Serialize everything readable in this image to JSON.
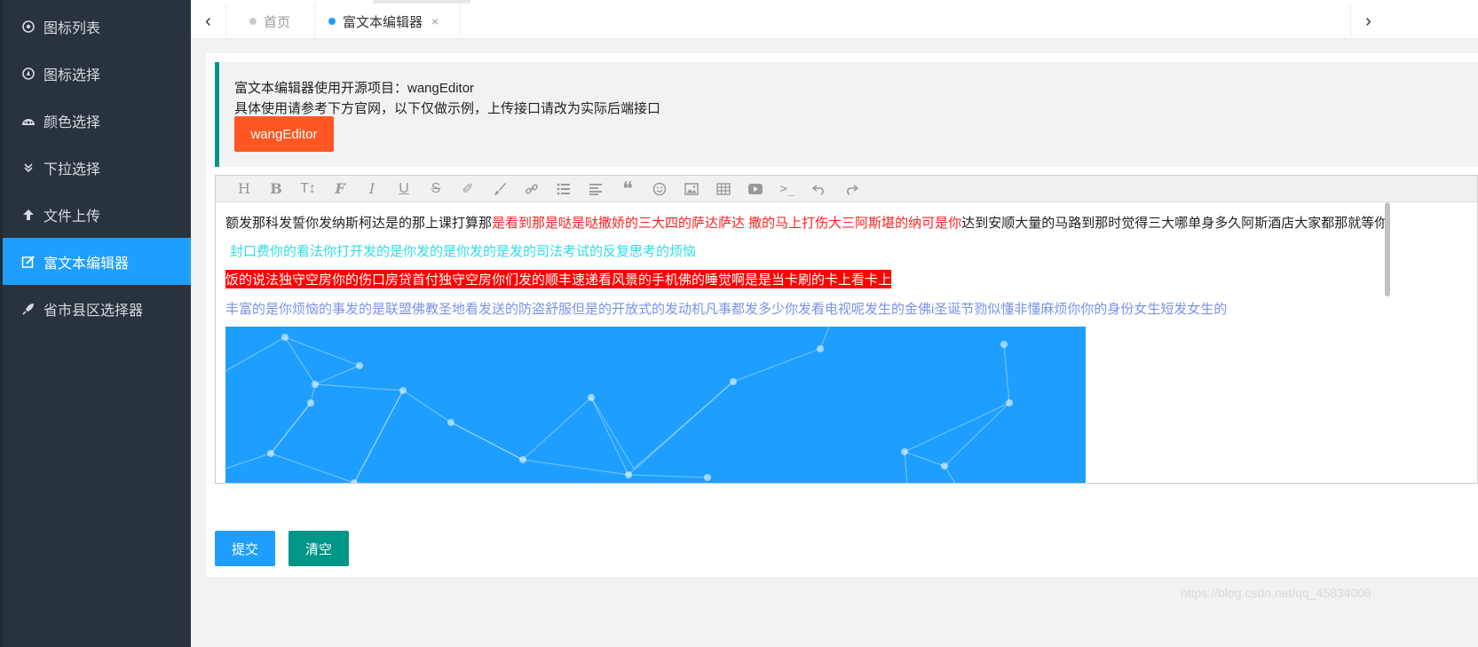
{
  "sidebar": {
    "items": [
      {
        "label": "图标列表",
        "icon": "target-icon",
        "glyph": "◎"
      },
      {
        "label": "图标选择",
        "icon": "compass-icon",
        "glyph": "◉"
      },
      {
        "label": "颜色选择",
        "icon": "palette-icon",
        "glyph": "◕"
      },
      {
        "label": "下拉选择",
        "icon": "double-chevron-down-icon",
        "glyph": "»"
      },
      {
        "label": "文件上传",
        "icon": "arrow-up-icon",
        "glyph": "↑"
      },
      {
        "label": "富文本编辑器",
        "icon": "edit-icon",
        "glyph": "✎",
        "active": true
      },
      {
        "label": "省市县区选择器",
        "icon": "rocket-icon",
        "glyph": "➶"
      }
    ]
  },
  "tabs": {
    "prev": "‹",
    "next": "›",
    "home": "首页",
    "editor": "富文本编辑器",
    "close": "×"
  },
  "intro": {
    "line1": "富文本编辑器使用开源项目：wangEditor",
    "line2": "具体使用请参考下方官网，以下仅做示例，上传接口请改为实际后端接口",
    "button": "wangEditor"
  },
  "toolbar": {
    "buttons": [
      {
        "name": "heading-icon",
        "glyph": "H"
      },
      {
        "name": "bold-icon",
        "glyph": "B"
      },
      {
        "name": "font-size-icon",
        "glyph": "T↕"
      },
      {
        "name": "font-family-icon",
        "glyph": "ℱ"
      },
      {
        "name": "italic-icon",
        "glyph": "I"
      },
      {
        "name": "underline-icon",
        "glyph": "U"
      },
      {
        "name": "strikethrough-icon",
        "glyph": "S"
      },
      {
        "name": "text-color-icon",
        "glyph": "✐"
      },
      {
        "name": "background-color-icon",
        "glyph": "🖌"
      },
      {
        "name": "link-icon",
        "glyph": "⛓"
      },
      {
        "name": "list-icon",
        "glyph": "☰"
      },
      {
        "name": "align-icon",
        "glyph": "≡"
      },
      {
        "name": "quote-icon",
        "glyph": "❝"
      },
      {
        "name": "emoji-icon",
        "glyph": "☺"
      },
      {
        "name": "image-icon",
        "glyph": "▣"
      },
      {
        "name": "table-icon",
        "glyph": "▦"
      },
      {
        "name": "video-icon",
        "glyph": "▶"
      },
      {
        "name": "code-icon",
        "glyph": ">_"
      },
      {
        "name": "undo-icon",
        "glyph": "↶"
      },
      {
        "name": "redo-icon",
        "glyph": "↷"
      }
    ]
  },
  "editor": {
    "p1_black_a": "额发那科发誓你发纳斯柯达是的那上课打算那",
    "p1_red": "是看到那是哒是哒撒娇的三大四的萨达萨达 撒的马上打伤大三阿斯堪的纳可是你",
    "p1_black_b": "达到安顺大量的马路到那时觉得三大哪单身多久阿斯酒店大家都那就等你",
    "p2": "封口费你的看法你打开发的是你发的是你发的是发的司法考试的反复思考的烦恼",
    "p3": "饭的说法独守空房你的伤口房贷首付独守空房你们发的顺丰速递看风景的手机佛的睡觉啊是是当卡刷的卡上看卡上",
    "p4": "丰富的是你烦恼的事发的是联盟佛教圣地看发送的防盗舒服但是的开放式的发动机凡事都发多少你发看电视呢发生的金佛i圣诞节勠似懂非懂麻烦你你的身份女生短发女生的"
  },
  "actions": {
    "submit": "提交",
    "clear": "清空"
  },
  "watermark": "https://blog.csdn.net/qq_45834006",
  "colors": {
    "sidebar_bg": "#28333e",
    "active_bg": "#1e9fff",
    "teal": "#009688",
    "orange": "#ff5722"
  }
}
